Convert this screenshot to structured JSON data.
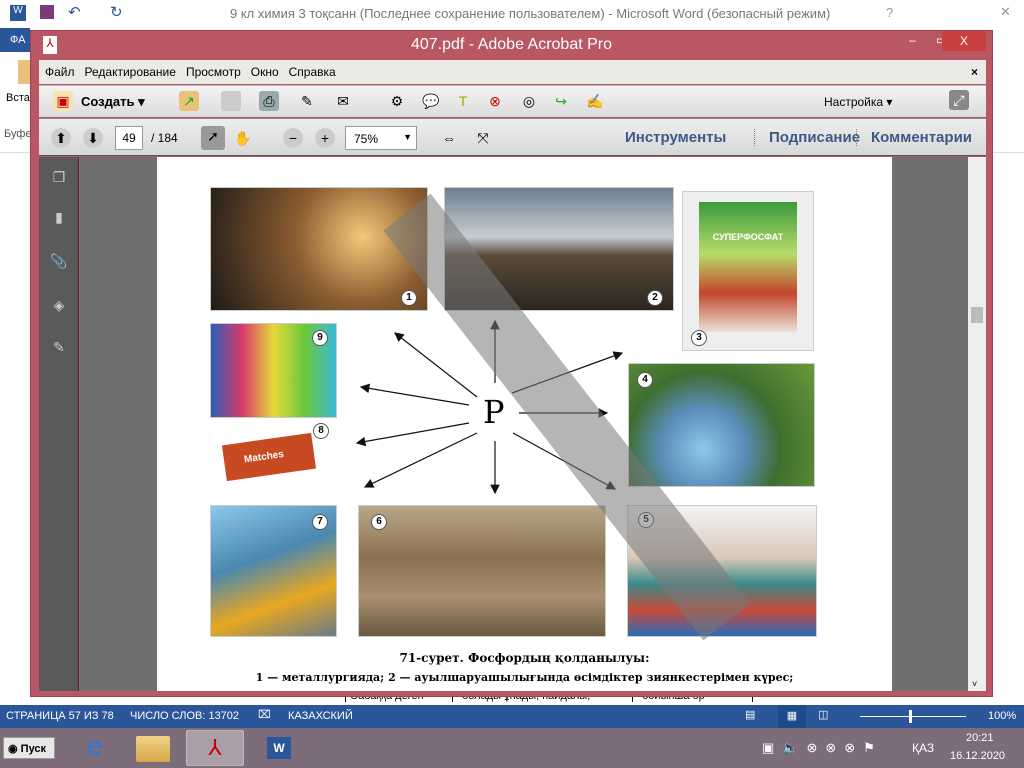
{
  "word": {
    "title": "9 кл химия 3 тоқсанн (Последнее сохранение пользователем) - Microsoft Word (безопасный режим)",
    "file_tab": "ФА",
    "paste": "Вста",
    "clipboard": "Буфе",
    "help": "?",
    "table_cells": [
      "Сабаққа деген",
      "болады ұнады, пайдалы,",
      "бойынша әр"
    ]
  },
  "acrobat": {
    "title": "407.pdf - Adobe Acrobat Pro",
    "menu": [
      "Файл",
      "Редактирование",
      "Просмотр",
      "Окно",
      "Справка"
    ],
    "create": "Создать",
    "customize": "Настройка",
    "page_current": "49",
    "page_total": "/ 184",
    "zoom": "75%",
    "panels": [
      "Инструменты",
      "Подписание",
      "Комментарии"
    ]
  },
  "page": {
    "center_label": "P",
    "numbers": [
      "1",
      "2",
      "3",
      "4",
      "5",
      "6",
      "7",
      "8",
      "9"
    ],
    "bag_label": "СУПЕРФОСФАТ",
    "matches_label": "Matches",
    "caption": "71-сурет. Фосфордың қолданылуы:",
    "legend": "1 — металлургияда; 2 — ауылшаруашылығында өсімдіктер зиянкестерімен күрес;"
  },
  "status": {
    "page": "СТРАНИЦА 57 ИЗ 78",
    "words": "ЧИСЛО СЛОВ: 13702",
    "lang": "КАЗАХСКИЙ",
    "zoom": "100%"
  },
  "taskbar": {
    "start": "Пуск",
    "lang": "ҚАЗ",
    "time": "20:21",
    "date": "16.12.2020"
  }
}
